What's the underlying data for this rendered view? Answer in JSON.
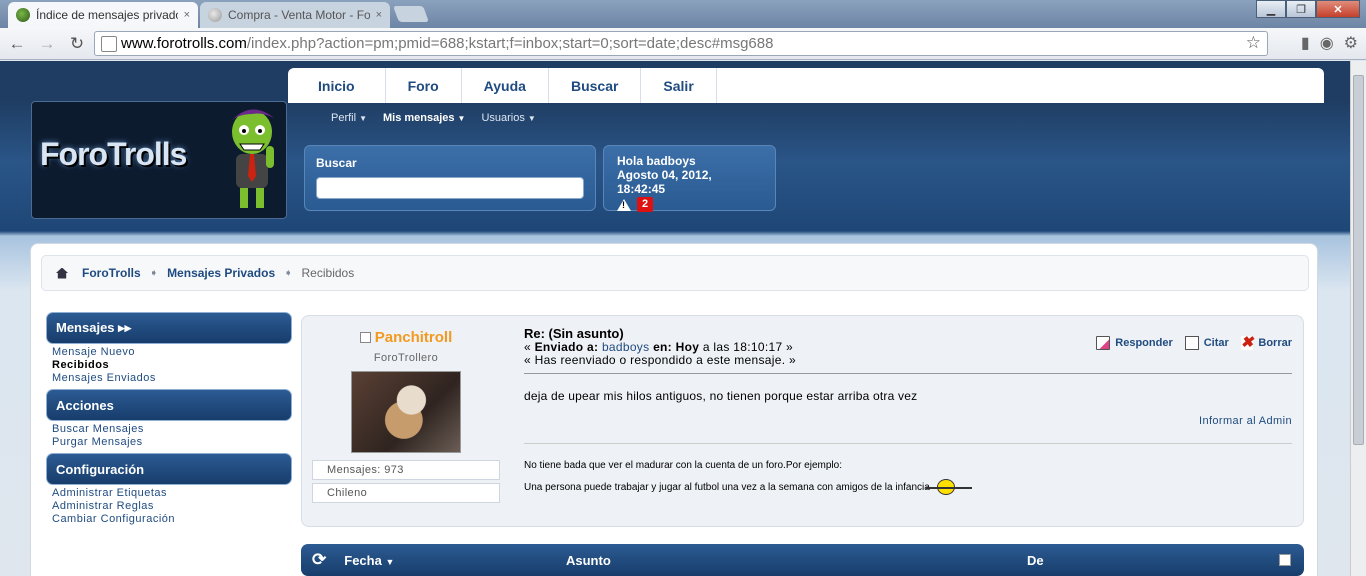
{
  "browser": {
    "tabs": [
      {
        "title": "Índice de mensajes privado",
        "close": "×"
      },
      {
        "title": "Compra - Venta Motor - Fo",
        "close": "×"
      }
    ],
    "window_controls": {
      "minimize": "▁",
      "maximize": "❐",
      "close": "✕"
    },
    "url": {
      "domain": "www.forotrolls.com",
      "path": "/index.php?action=pm;pmid=688;kstart;f=inbox;start=0;sort=date;desc#msg688"
    }
  },
  "site": {
    "logo_text": "ForoTrolls",
    "topmenu": [
      "Inicio",
      "Foro",
      "Ayuda",
      "Buscar",
      "Salir"
    ],
    "submenu": [
      "Perfil",
      "Mis mensajes",
      "Usuarios"
    ],
    "search_label": "Buscar",
    "search_value": "",
    "user": {
      "greeting": "Hola badboys",
      "datetime": "Agosto 04, 2012, 18:42:45",
      "alerts_count": "2"
    }
  },
  "breadcrumb": [
    "ForoTrolls",
    "Mensajes Privados",
    "Recibidos"
  ],
  "sidebar": {
    "sections": [
      {
        "title": "Mensajes ▸▸",
        "links": [
          "Mensaje Nuevo",
          "Recibidos",
          "Mensajes Enviados"
        ]
      },
      {
        "title": "Acciones",
        "links": [
          "Buscar Mensajes",
          "Purgar Mensajes"
        ]
      },
      {
        "title": "Configuración",
        "links": [
          "Administrar Etiquetas",
          "Administrar Reglas",
          "Cambiar Configuración"
        ]
      }
    ]
  },
  "post": {
    "poster": {
      "name": "Panchitroll",
      "rank": "ForoTrollero",
      "messages": "Mensajes: 973",
      "location": "Chileno"
    },
    "subject": "Re: (Sin asunto)",
    "sent_prefix": "« ",
    "sent_label": "Enviado a:",
    "sent_to": "badboys",
    "sent_on_label": "en:",
    "sent_day": "Hoy",
    "sent_time": "a las 18:10:17 »",
    "reply_note": "« Has reenviado o respondido a este mensaje. »",
    "actions": {
      "reply": "Responder",
      "quote": "Citar",
      "delete": "Borrar"
    },
    "text": "deja de upear mis hilos antiguos, no tienen porque estar arriba otra vez",
    "report": "Informar al Admin",
    "signature": [
      "No tiene bada que ver el madurar con la cuenta de un foro.Por ejemplo:",
      "Una persona puede trabajar y jugar al futbol una vez a la semana con amigos de la infancia"
    ]
  },
  "list_header": {
    "date": "Fecha",
    "subject": "Asunto",
    "from": "De"
  },
  "colors": {
    "header_dark": "#1f3d63",
    "accent_orange": "#f29a1f",
    "link_blue": "#1f4b80"
  }
}
